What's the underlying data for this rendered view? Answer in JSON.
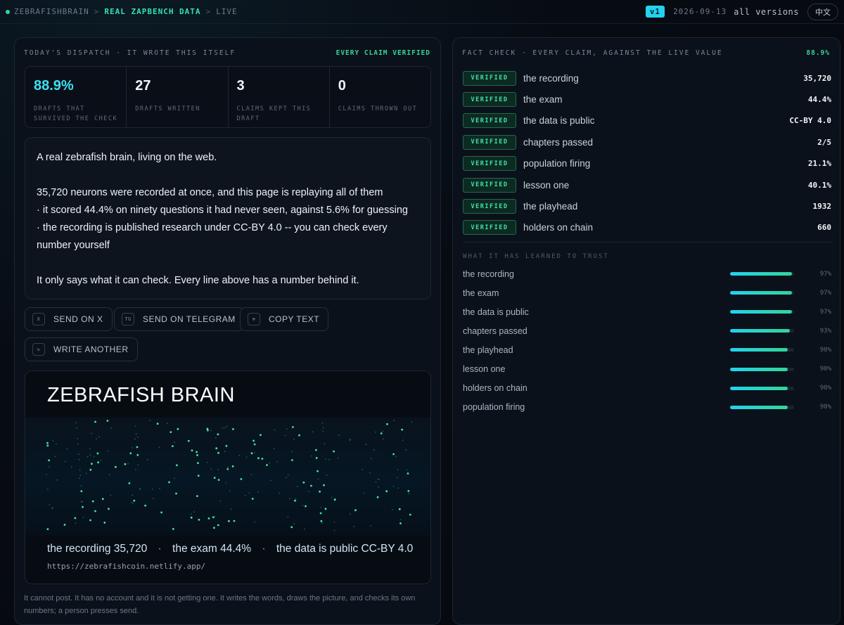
{
  "breadcrumb": {
    "items": [
      "ZEBRAFISHBRAIN",
      "REAL ZAPBENCH DATA",
      "LIVE"
    ]
  },
  "topbar": {
    "version": "v1",
    "date": "2026-09-13",
    "versions_label": "all versions",
    "language": "中文"
  },
  "dispatch": {
    "header": "TODAY'S DISPATCH · IT WROTE THIS ITSELF",
    "status": "EVERY CLAIM VERIFIED",
    "stats": [
      {
        "value": "88.9%",
        "label": "DRAFTS THAT SURVIVED THE CHECK"
      },
      {
        "value": "27",
        "label": "DRAFTS WRITTEN"
      },
      {
        "value": "3",
        "label": "CLAIMS KEPT THIS DRAFT"
      },
      {
        "value": "0",
        "label": "CLAIMS THROWN OUT"
      }
    ],
    "message": {
      "line1": "A real zebrafish brain, living on the web.",
      "line2": "35,720 neurons were recorded at once, and this page is replaying all of them",
      "line3": "· it scored 44.4% on ninety questions it had never seen, against 5.6% for guessing",
      "line4": "· the recording is published research under CC-BY 4.0 -- you can check every number yourself",
      "line5": "It only says what it can check. Every line above has a number behind it."
    },
    "actions": {
      "send_x": {
        "icon": "X",
        "label": "SEND ON X"
      },
      "send_tg": {
        "icon": "TG",
        "label": "SEND ON TELEGRAM"
      },
      "copy": {
        "icon": "⊕",
        "label": "COPY TEXT"
      },
      "another": {
        "icon": "↻",
        "label": "WRITE ANOTHER"
      }
    },
    "card": {
      "title": "ZEBRAFISH BRAIN",
      "metrics": [
        {
          "name": "the recording",
          "value": "35,720"
        },
        {
          "name": "the exam",
          "value": "44.4%"
        },
        {
          "name": "the data is public",
          "value": "CC-BY 4.0"
        }
      ],
      "separator": "·",
      "url": "https://zebrafishcoin.netlify.app/"
    },
    "footnote": "It cannot post. It has no account and it is not getting one. It writes the words, draws the picture, and checks its own numbers; a person presses send."
  },
  "fact_check": {
    "header": "FACT CHECK · EVERY CLAIM, AGAINST THE LIVE VALUE",
    "score": "88.9%",
    "badge": "VERIFIED",
    "claims": [
      {
        "name": "the recording",
        "value": "35,720"
      },
      {
        "name": "the exam",
        "value": "44.4%"
      },
      {
        "name": "the data is public",
        "value": "CC-BY 4.0"
      },
      {
        "name": "chapters passed",
        "value": "2/5"
      },
      {
        "name": "population firing",
        "value": "21.1%"
      },
      {
        "name": "lesson one",
        "value": "40.1%"
      },
      {
        "name": "the playhead",
        "value": "1932"
      },
      {
        "name": "holders on chain",
        "value": "660"
      }
    ]
  },
  "trust": {
    "header": "WHAT IT HAS LEARNED TO TRUST",
    "items": [
      {
        "name": "the recording",
        "value": 0.97,
        "label": "97%"
      },
      {
        "name": "the exam",
        "value": 0.97,
        "label": "97%"
      },
      {
        "name": "the data is public",
        "value": 0.97,
        "label": "97%"
      },
      {
        "name": "chapters passed",
        "value": 0.93,
        "label": "93%"
      },
      {
        "name": "the playhead",
        "value": 0.9,
        "label": "90%"
      },
      {
        "name": "lesson one",
        "value": 0.9,
        "label": "90%"
      },
      {
        "name": "holders on chain",
        "value": 0.9,
        "label": "90%"
      },
      {
        "name": "population firing",
        "value": 0.9,
        "label": "90%"
      }
    ]
  },
  "colors": {
    "accent": "#22d3ee",
    "verified": "#34d399",
    "background": "#070b12"
  }
}
